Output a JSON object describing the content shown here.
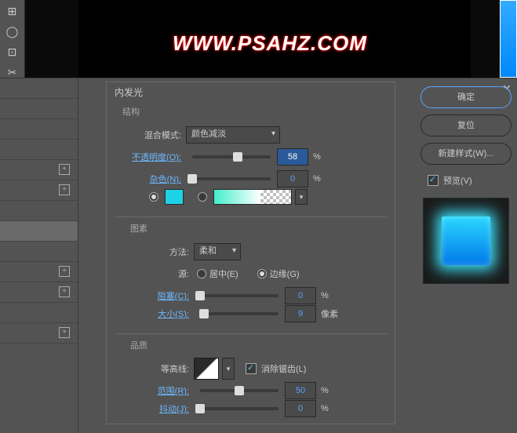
{
  "canvas": {
    "watermark": "WWW.PSAHZ.COM"
  },
  "dialog": {
    "title": "内发光",
    "structure": {
      "heading": "结构",
      "blend_label": "混合模式:",
      "blend_value": "颜色减淡",
      "opacity_label": "不透明度(O):",
      "opacity_value": "58",
      "opacity_unit": "%",
      "noise_label": "杂色(N):",
      "noise_value": "0",
      "noise_unit": "%",
      "color_hex": "#1ed2e6"
    },
    "elements": {
      "heading": "图素",
      "technique_label": "方法:",
      "technique_value": "柔和",
      "source_label": "源:",
      "source_center": "居中(E)",
      "source_edge": "边缘(G)",
      "choke_label": "阻塞(C):",
      "choke_value": "0",
      "choke_unit": "%",
      "size_label": "大小(S):",
      "size_value": "9",
      "size_unit": "像素"
    },
    "quality": {
      "heading": "品质",
      "contour_label": "等高线:",
      "antialias_label": "消除锯齿(L)",
      "range_label": "范围(R):",
      "range_value": "50",
      "range_unit": "%",
      "jitter_label": "抖动(J):",
      "jitter_value": "0",
      "jitter_unit": "%"
    }
  },
  "buttons": {
    "ok": "确定",
    "reset": "复位",
    "new_style": "新建样式(W)...",
    "preview": "预览(V)"
  }
}
